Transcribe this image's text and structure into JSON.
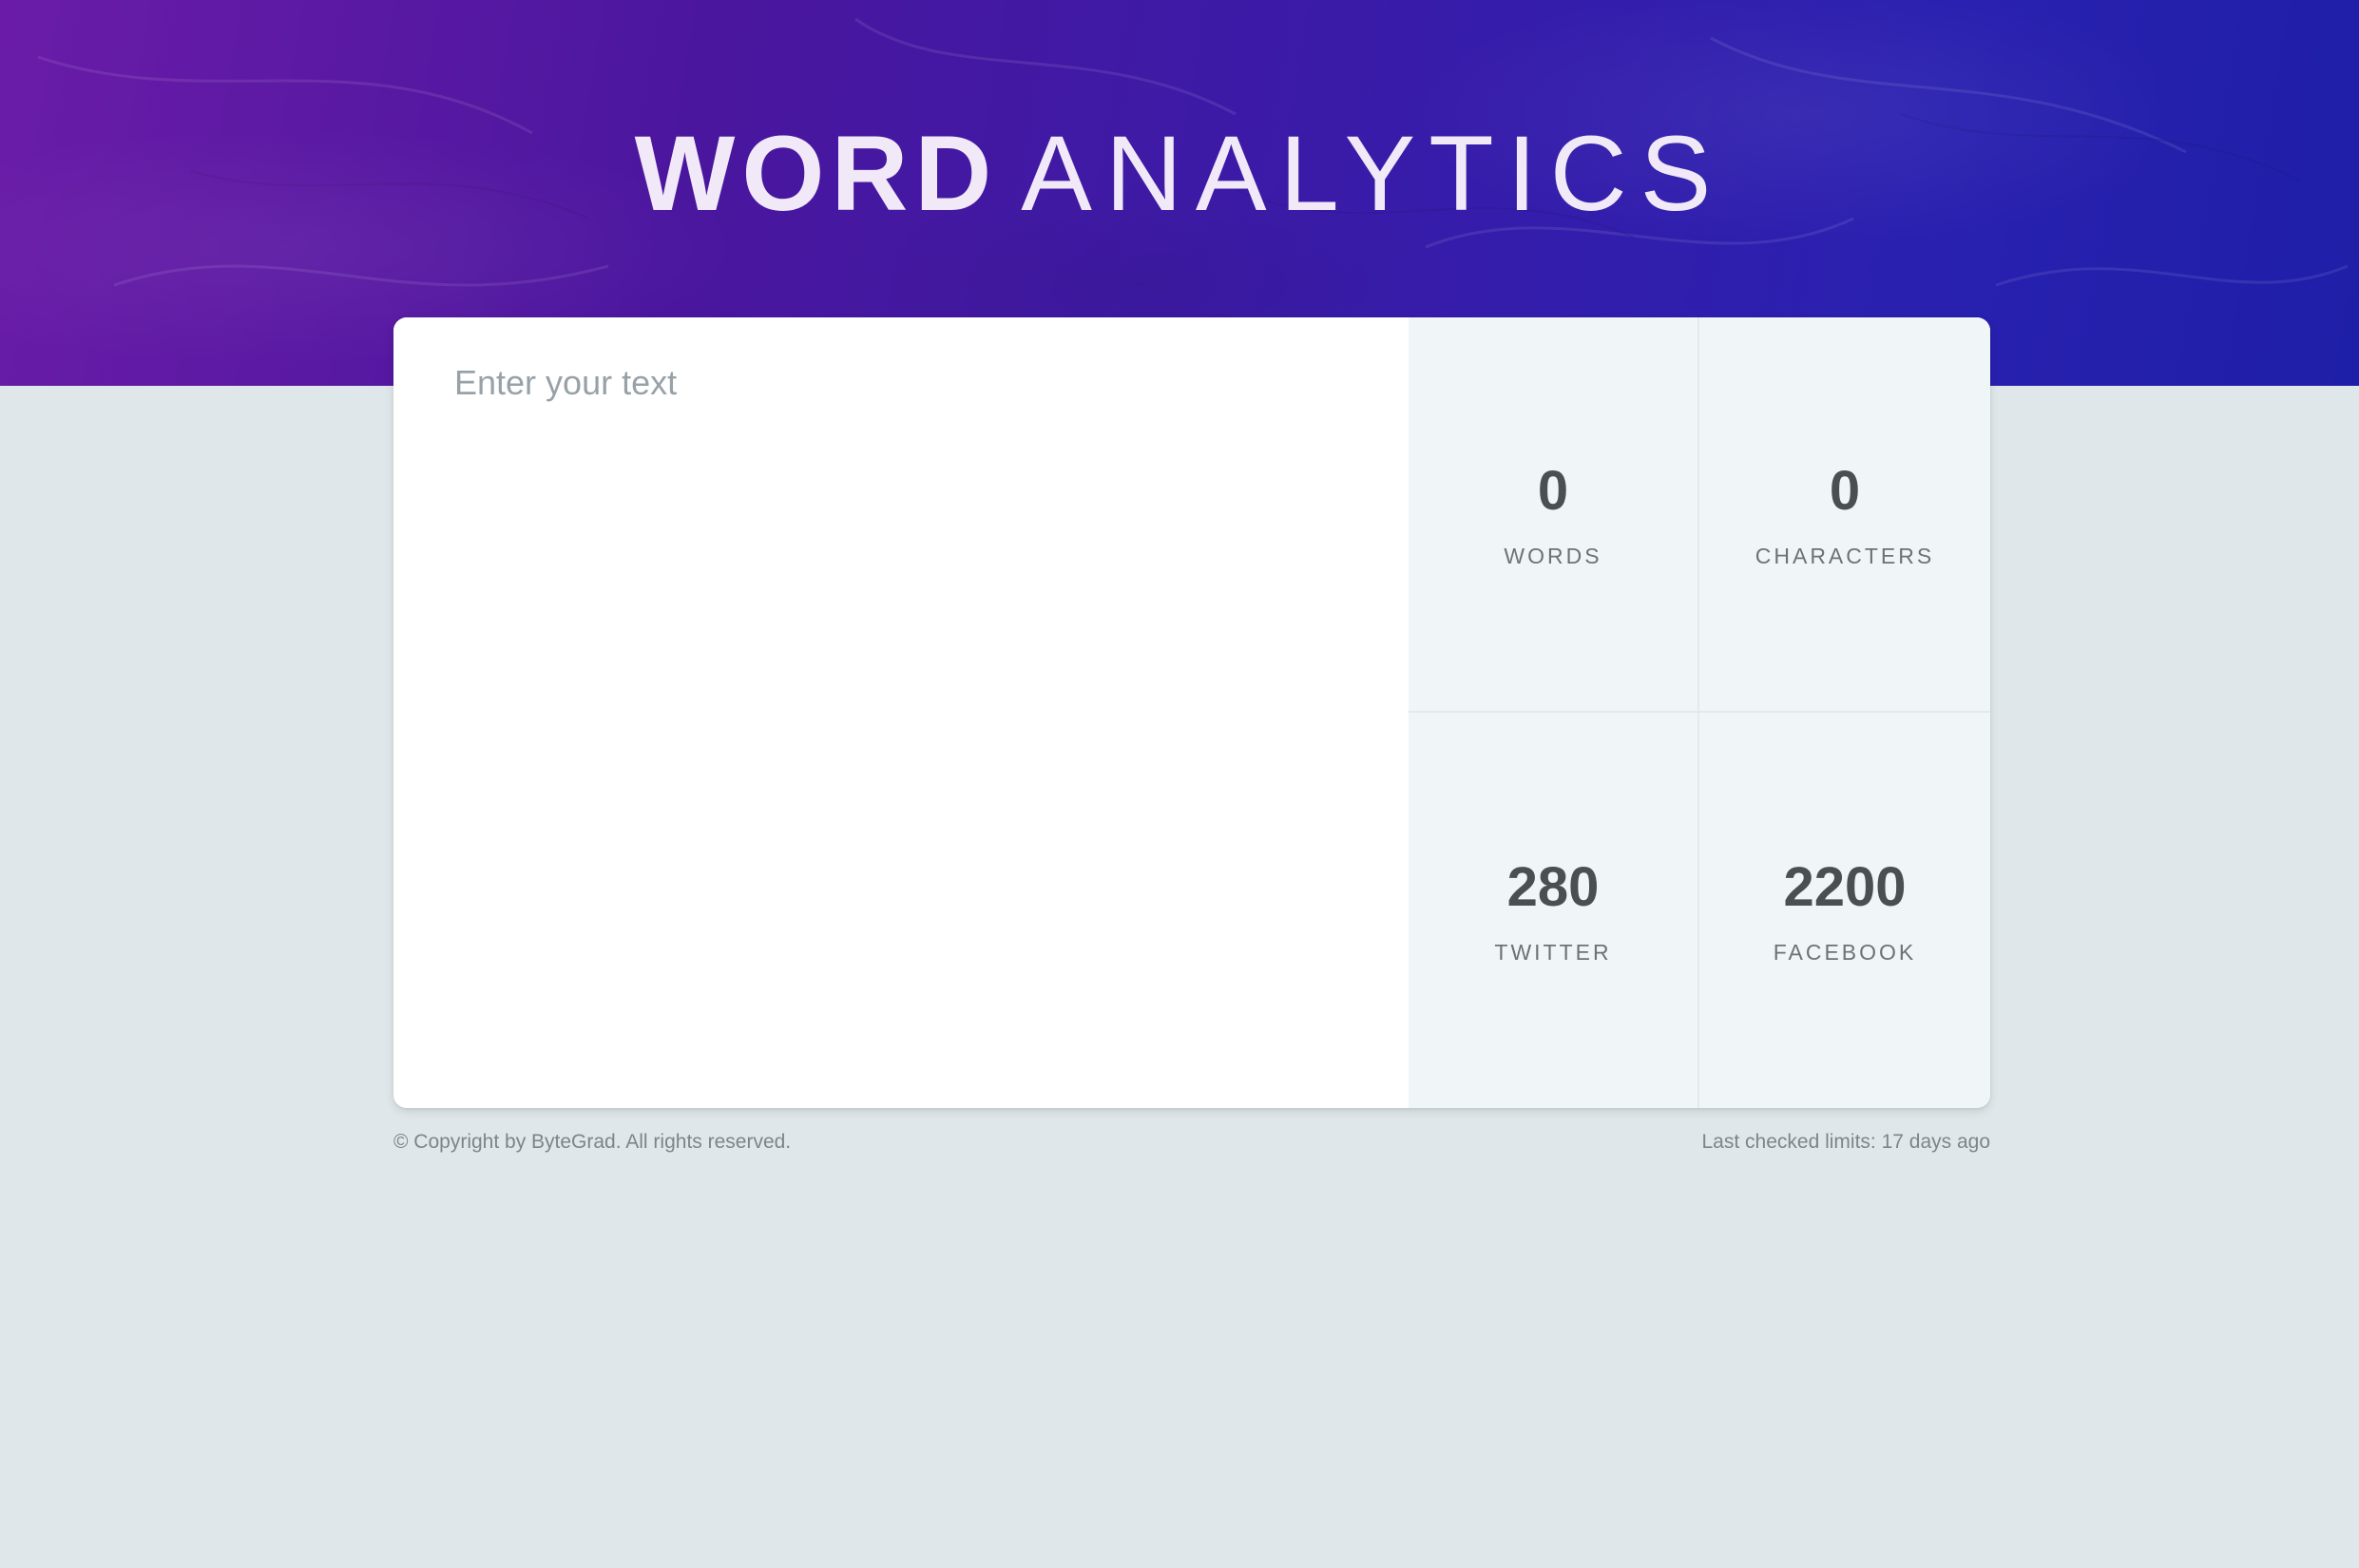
{
  "header": {
    "title_bold": "WORD",
    "title_light": "ANALYTICS"
  },
  "editor": {
    "placeholder": "Enter your text",
    "value": ""
  },
  "stats": [
    {
      "value": "0",
      "label": "WORDS"
    },
    {
      "value": "0",
      "label": "CHARACTERS"
    },
    {
      "value": "280",
      "label": "TWITTER"
    },
    {
      "value": "2200",
      "label": "FACEBOOK"
    }
  ],
  "footer": {
    "copyright": "© Copyright by ByteGrad. All rights reserved.",
    "last_checked": "Last checked limits: 17 days ago"
  },
  "colors": {
    "hero_start": "#6a1ca8",
    "hero_end": "#1e1fa8",
    "page_background": "#e0e7ea",
    "stats_background": "#f0f5f8",
    "stat_number": "#4a5052"
  }
}
